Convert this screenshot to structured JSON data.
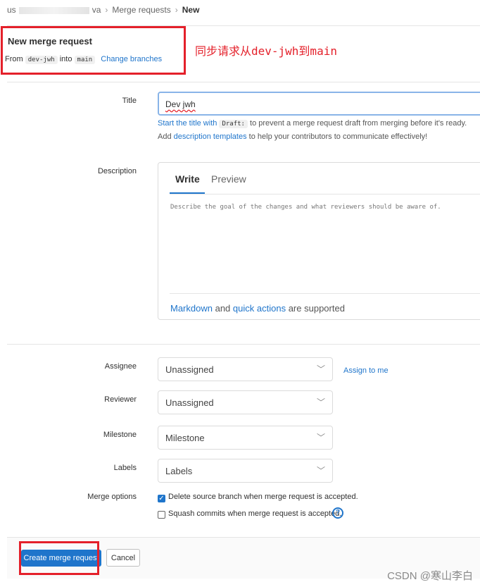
{
  "breadcrumb": {
    "user": "us",
    "project": "va",
    "section": "Merge requests",
    "current": "New"
  },
  "header": {
    "title": "New merge request",
    "from_word": "From",
    "source_branch": "dev-jwh",
    "into_word": "into",
    "target_branch": "main",
    "change_branches": "Change branches"
  },
  "annotation": "同步请求从dev-jwh到main",
  "form": {
    "title_label": "Title",
    "title_value": "Dev jwh",
    "help1_prefix": "Start the title with",
    "help1_code": "Draft:",
    "help1_suffix": "to prevent a merge request draft from merging before it's ready.",
    "help2_prefix": "Add",
    "help2_link": "description templates",
    "help2_suffix": "to help your contributors to communicate effectively!",
    "description_label": "Description",
    "tab_write": "Write",
    "tab_preview": "Preview",
    "description_placeholder": "Describe the goal of the changes and what reviewers should be aware of.",
    "md_link": "Markdown",
    "md_and": "and",
    "qa_link": "quick actions",
    "md_suffix": "are supported",
    "assignee_label": "Assignee",
    "assignee_value": "Unassigned",
    "assign_to_me": "Assign to me",
    "reviewer_label": "Reviewer",
    "reviewer_value": "Unassigned",
    "milestone_label": "Milestone",
    "milestone_value": "Milestone",
    "labels_label": "Labels",
    "labels_value": "Labels",
    "merge_options_label": "Merge options",
    "delete_source_label": "Delete source branch when merge request is accepted.",
    "delete_source_checked": true,
    "squash_label": "Squash commits when merge request is accepted.",
    "squash_checked": false
  },
  "footer": {
    "create_button": "Create merge request",
    "cancel_button": "Cancel"
  },
  "watermark": "CSDN @寒山李白",
  "colors": {
    "accent": "#1f75cb",
    "annotation_red": "#e4202a"
  }
}
